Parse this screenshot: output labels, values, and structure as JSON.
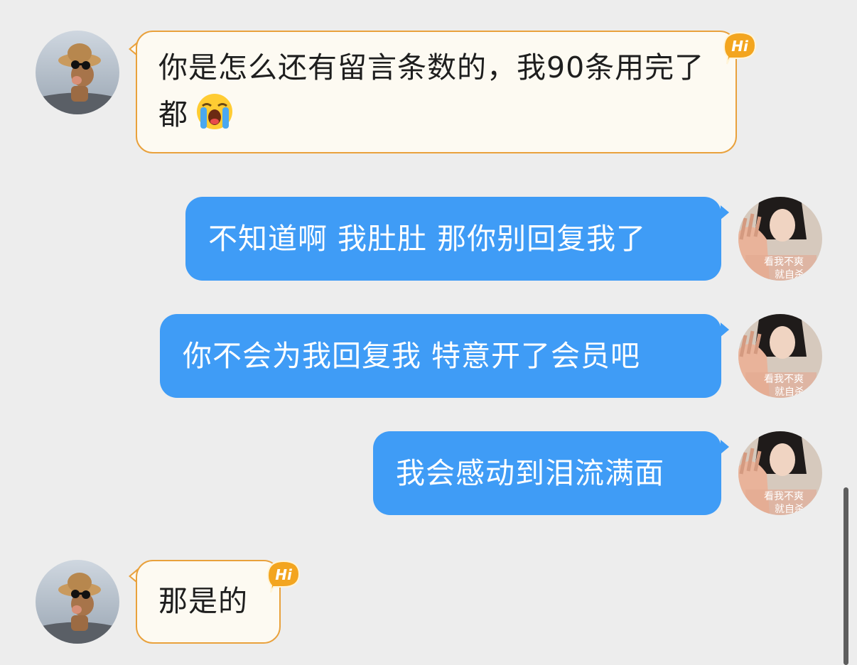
{
  "messages": [
    {
      "direction": "in",
      "text": "你是怎么还有留言条数的，我90条用完了都",
      "emoji": "loudly-crying-face-emoji"
    },
    {
      "direction": "out",
      "text": "不知道啊 我肚肚 那你别回复我了"
    },
    {
      "direction": "out",
      "text": "你不会为我回复我 特意开了会员吧"
    },
    {
      "direction": "out",
      "text": "我会感动到泪流满面"
    },
    {
      "direction": "in",
      "text": "那是的"
    }
  ],
  "badge": {
    "label": "Hi"
  },
  "avatar_overlay_text": {
    "line1": "看我不爽",
    "line2": "就自杀"
  },
  "colors": {
    "background": "#ededed",
    "incoming_bubble": "#fdfaf2",
    "incoming_border": "#e9a13c",
    "outgoing_bubble": "#3f9cf6",
    "badge": "#f3a51f"
  }
}
